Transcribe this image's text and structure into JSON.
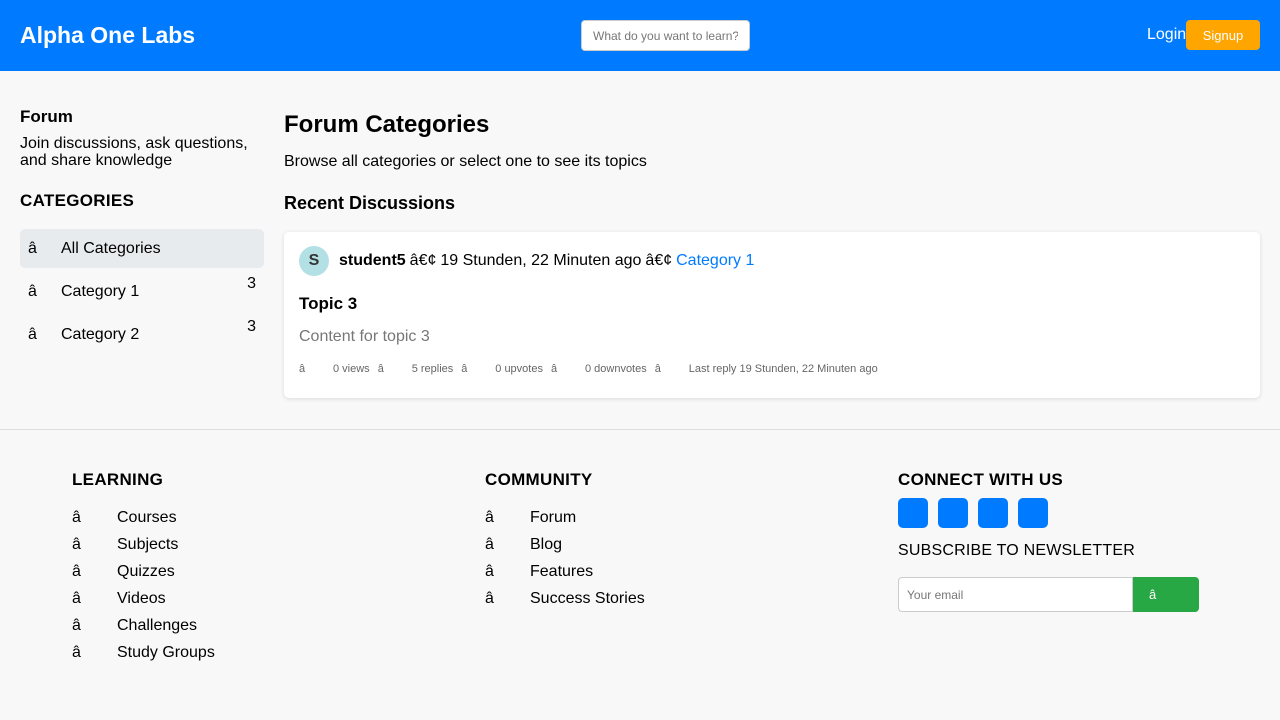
{
  "header": {
    "brand": "Alpha One Labs",
    "search_placeholder": "What do you want to learn?",
    "login_label": "Login",
    "signup_label": "Signup",
    "accent_color": "#007bff",
    "signup_color": "#ffa500"
  },
  "sidebar": {
    "title": "Forum",
    "description": "Join discussions, ask questions, and share knowledge",
    "categories_heading": "CATEGORIES",
    "categories": [
      {
        "icon": "â",
        "label": "All Categories",
        "count": "",
        "active": true
      },
      {
        "icon": "â",
        "label": "Category 1",
        "count": "3",
        "active": false
      },
      {
        "icon": "â",
        "label": "Category 2",
        "count": "3",
        "active": false
      }
    ]
  },
  "main": {
    "title": "Forum Categories",
    "subtitle": "Browse all categories or select one to see its topics",
    "recent_heading": "Recent Discussions",
    "discussion": {
      "avatar_letter": "S",
      "author": "student5",
      "separator": "â€¢",
      "time": "19 Stunden, 22 Minuten ago",
      "category": "Category 1",
      "title": "Topic 3",
      "content": "Content for topic 3",
      "stats": [
        {
          "icon": "â",
          "text": "0 views"
        },
        {
          "icon": "â",
          "text": "5 replies"
        },
        {
          "icon": "â",
          "text": "0 upvotes"
        },
        {
          "icon": "â",
          "text": "0 downvotes"
        },
        {
          "icon": "â",
          "text": "Last reply 19 Stunden, 22 Minuten ago"
        }
      ]
    }
  },
  "footer": {
    "learning": {
      "title": "LEARNING",
      "items": [
        {
          "icon": "â",
          "label": "Courses"
        },
        {
          "icon": "â",
          "label": "Subjects"
        },
        {
          "icon": "â",
          "label": "Quizzes"
        },
        {
          "icon": "â",
          "label": "Videos"
        },
        {
          "icon": "â",
          "label": "Challenges"
        },
        {
          "icon": "â",
          "label": "Study Groups"
        }
      ]
    },
    "community": {
      "title": "COMMUNITY",
      "items": [
        {
          "icon": "â",
          "label": "Forum"
        },
        {
          "icon": "â",
          "label": "Blog"
        },
        {
          "icon": "â",
          "label": "Features"
        },
        {
          "icon": "â",
          "label": "Success Stories"
        }
      ]
    },
    "connect": {
      "title": "CONNECT WITH US",
      "socials": [
        "social-icon-1",
        "social-icon-2",
        "social-icon-3",
        "social-icon-4"
      ],
      "newsletter_title": "SUBSCRIBE TO NEWSLETTER",
      "email_placeholder": "Your email",
      "subscribe_icon": "â",
      "subscribe_color": "#28a745"
    }
  }
}
